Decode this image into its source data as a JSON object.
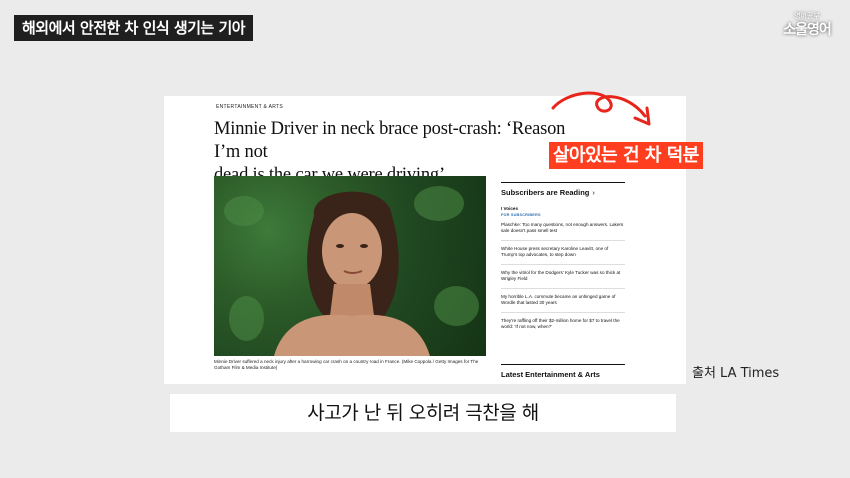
{
  "video": {
    "title": "해외에서 안전한 차 인식 생기는 기아",
    "logo_small": "영어공부",
    "logo_big": "소울영어",
    "badge": "살아있는 건 차 덕분",
    "source": "출처 LA Times",
    "subtitle": "사고가 난 뒤 오히려 극찬을 해",
    "badge_color": "#ff3e1f",
    "arrow_color": "#e8251b"
  },
  "article": {
    "section": "ENTERTAINMENT & ARTS",
    "headline_line1": "Minnie Driver in neck brace post-crash: ‘Reason I’m not",
    "headline_line2": "dead is the car we were driving’",
    "caption": "Minnie Driver suffered a neck injury after a harrowing car crash on a country road in France. (Mike Coppola / Getty Images for The Gotham Film & Media Institute)"
  },
  "sidebar": {
    "title": "Subscribers are Reading",
    "first_label": "I Voices",
    "first_sub": "FOR SUBSCRIBERS",
    "first_text": "Plaschke: Too many questions, not enough answers. Lakers sale doesn't pass smell test",
    "items": [
      "White House press secretary Karoline Leavitt, one of Trump's top advocates, to step down",
      "Why the vitriol for the Dodgers' Kyle Tucker was so thick at Wrigley Field",
      "My horrible L.A. commute became an unhinged game of Wordle that lasted 30 years",
      "They're raffling off their $2-million home for $7 to travel the world: 'If not now, when?'"
    ],
    "latest": "Latest Entertainment & Arts"
  }
}
